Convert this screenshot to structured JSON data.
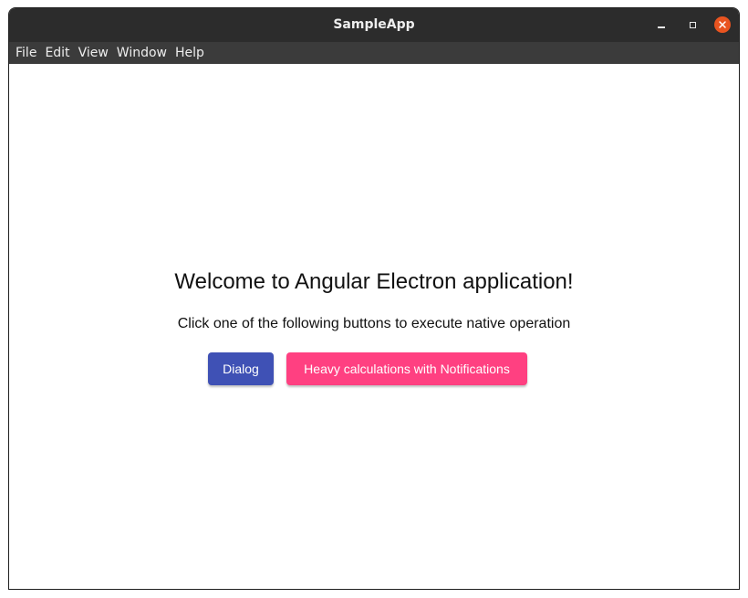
{
  "window": {
    "title": "SampleApp",
    "controls": {
      "minimize": "minimize-icon",
      "maximize": "maximize-icon",
      "close": "close-icon"
    },
    "close_color": "#e95420"
  },
  "menubar": {
    "items": [
      "File",
      "Edit",
      "View",
      "Window",
      "Help"
    ]
  },
  "main": {
    "heading": "Welcome to Angular Electron application!",
    "subheading": "Click one of the following buttons to execute native operation",
    "buttons": {
      "dialog": "Dialog",
      "heavy": "Heavy calculations with Notifications"
    }
  },
  "colors": {
    "primary": "#3f51b5",
    "accent": "#ff4081",
    "titlebar": "#2c2c2c",
    "menubar": "#3b3b3b"
  }
}
